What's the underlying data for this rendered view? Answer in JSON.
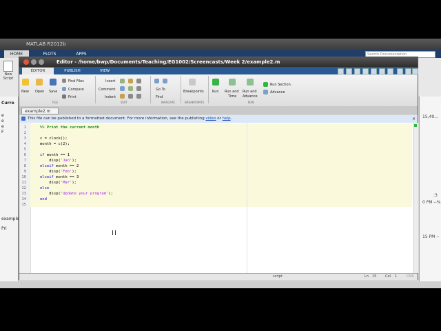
{
  "main_window": {
    "title": "MATLAB R2012b",
    "tabs": [
      "HOME",
      "PLOTS",
      "APPS"
    ],
    "search_placeholder": "Search Documentation",
    "new_script_label": "New Script",
    "left_panel": {
      "current_folder_label": "Curre",
      "items": [
        "e",
        "e",
        "e",
        "F"
      ],
      "workspace_label": "example",
      "bottom_item": "Pri"
    },
    "right_panel": {
      "lines": [
        "15,49...",
        ":3",
        "0 PM --%",
        "15 PM --"
      ]
    }
  },
  "editor": {
    "title": "Editor - /home/bwp/Documents/Teaching/EG1002/Screencasts/Week 2/example2.m",
    "tabs": [
      "EDITOR",
      "PUBLISH",
      "VIEW"
    ],
    "active_tab": "EDITOR",
    "ribbon": {
      "file": {
        "new": "New",
        "open": "Open",
        "save": "Save",
        "find_files": "Find Files",
        "compare": "Compare",
        "print": "Print",
        "group": "FILE"
      },
      "edit": {
        "insert": "Insert",
        "comment": "Comment",
        "indent": "Indent",
        "group": "EDIT"
      },
      "navigate": {
        "go_to": "Go To",
        "find": "Find",
        "group": "NAVIGATE"
      },
      "breakpoints": {
        "label": "Breakpoints",
        "group": "BREAKPOINTS"
      },
      "run": {
        "run": "Run",
        "run_and_time_1": "Run and",
        "run_and_time_2": "Time",
        "run_and_advance_1": "Run and",
        "run_and_advance_2": "Advance",
        "run_section": "Run Section",
        "advance": "Advance",
        "group": "RUN"
      }
    },
    "document_tab": "example2.m",
    "infobar": {
      "text_before": "This file can be published to a formatted document. For more information, see the publishing",
      "video_link": "video",
      "or_text": "or",
      "help_link": "help",
      "period": "."
    },
    "code_lines": [
      {
        "n": "1",
        "text": "%% Print the current month",
        "type": "comment"
      },
      {
        "n": "2",
        "text": "",
        "type": "plain"
      },
      {
        "n": "3",
        "text": "c = clock();",
        "type": "plain"
      },
      {
        "n": "4",
        "text": "month = c(2);",
        "type": "plain"
      },
      {
        "n": "5",
        "text": "",
        "type": "plain"
      },
      {
        "n": "6",
        "kw": "if",
        "rest": " month == 1",
        "type": "kw"
      },
      {
        "n": "7",
        "pre": "    disp(",
        "str": "'Jan'",
        "post": ");",
        "type": "str"
      },
      {
        "n": "8",
        "kw": "elseif",
        "rest": " month == 2",
        "type": "kw"
      },
      {
        "n": "9",
        "pre": "    disp(",
        "str": "'Feb'",
        "post": ");",
        "type": "str"
      },
      {
        "n": "10",
        "kw": "elseif",
        "rest": " month == 3",
        "type": "kw"
      },
      {
        "n": "11",
        "pre": "    disp(",
        "str": "'Mar'",
        "post": ");",
        "type": "str"
      },
      {
        "n": "12",
        "kw": "else",
        "rest": "",
        "type": "kw"
      },
      {
        "n": "13",
        "pre": "    disp(",
        "str": "'Update your program'",
        "post": ");",
        "type": "str"
      },
      {
        "n": "14",
        "kw": "end",
        "rest": "",
        "type": "kw"
      },
      {
        "n": "15",
        "text": "",
        "type": "plain"
      }
    ],
    "status": {
      "mode": "script",
      "ln_label": "Ln",
      "ln_value": "15",
      "col_label": "Col",
      "col_value": "1",
      "ovr": "OVR"
    }
  },
  "colors": {
    "keyword": "#0000e6",
    "string": "#a020f0",
    "comment": "#228b22",
    "cell_background": "#fbf9dc",
    "tab_bar": "#2a5a93"
  }
}
